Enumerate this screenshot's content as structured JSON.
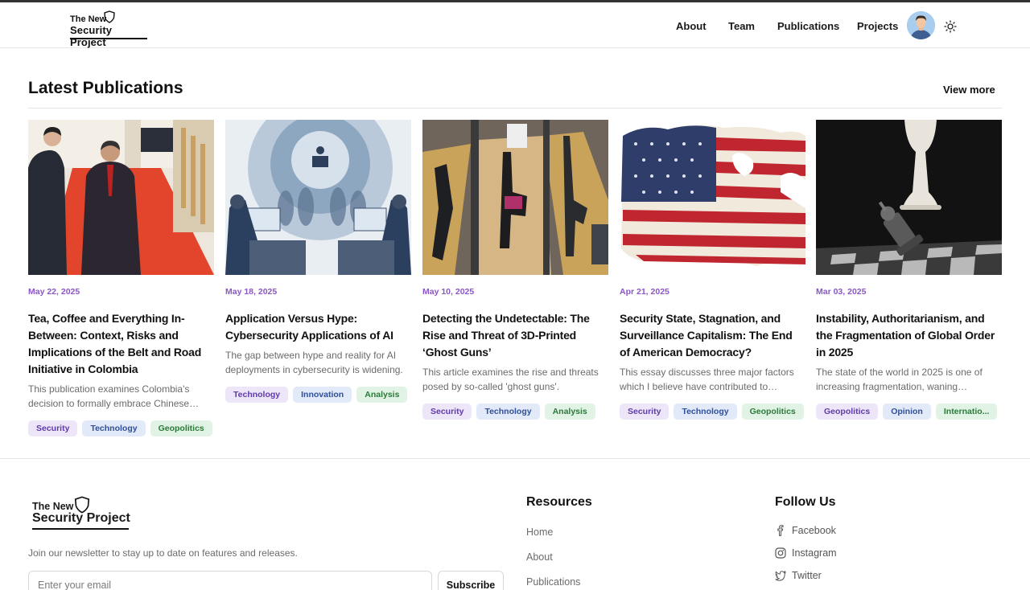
{
  "header": {
    "logo_line1": "The New",
    "logo_line2": "Security Project",
    "nav": [
      "About",
      "Team",
      "Publications",
      "Projects"
    ]
  },
  "section": {
    "title": "Latest Publications",
    "view_more": "View more"
  },
  "publications": [
    {
      "date": "May 22, 2025",
      "title": "Tea, Coffee and Everything In-Between: Context, Risks and Implications of the Belt and Road Initiative in Colombia",
      "description": "This publication examines Colombia's decision to formally embrace Chinese…",
      "tags": [
        "Security",
        "Technology",
        "Geopolitics"
      ]
    },
    {
      "date": "May 18, 2025",
      "title": "Application Versus Hype: Cybersecurity Applications of AI",
      "description": "The gap between hype and reality for AI deployments in cybersecurity is widening.",
      "tags": [
        "Technology",
        "Innovation",
        "Analysis"
      ]
    },
    {
      "date": "May 10, 2025",
      "title": "Detecting the Undetectable: The Rise and Threat of 3D-Printed ‘Ghost Guns’",
      "description": "This article examines the rise and threats posed by so-called 'ghost guns'.",
      "tags": [
        "Security",
        "Technology",
        "Analysis"
      ]
    },
    {
      "date": "Apr 21, 2025",
      "title": "Security State, Stagnation, and Surveillance Capitalism: The End of American Democracy?",
      "description": "This essay discusses three major factors which I believe have contributed to…",
      "tags": [
        "Security",
        "Technology",
        "Geopolitics"
      ]
    },
    {
      "date": "Mar 03, 2025",
      "title": "Instability, Authoritarianism, and the Fragmentation of Global Order in 2025",
      "description": "The state of the world in 2025 is one of increasing fragmentation, waning…",
      "tags": [
        "Geopolitics",
        "Opinion",
        "Internatio..."
      ]
    }
  ],
  "footer": {
    "logo_line1": "The New",
    "logo_line2": "Security Project",
    "newsletter_text": "Join our newsletter to stay up to date on features and releases.",
    "email_placeholder": "Enter your email",
    "subscribe_label": "Subscribe",
    "resources_title": "Resources",
    "resources": [
      "Home",
      "About",
      "Publications"
    ],
    "follow_title": "Follow Us",
    "social": [
      {
        "label": "Facebook",
        "icon": "facebook-icon"
      },
      {
        "label": "Instagram",
        "icon": "instagram-icon"
      },
      {
        "label": "Twitter",
        "icon": "twitter-icon"
      }
    ]
  },
  "colors": {
    "accent_date": "#8a57c7",
    "tag_purple": "#ece6f8",
    "tag_blue": "#e2e9f8",
    "tag_green": "#e0f3e4"
  }
}
